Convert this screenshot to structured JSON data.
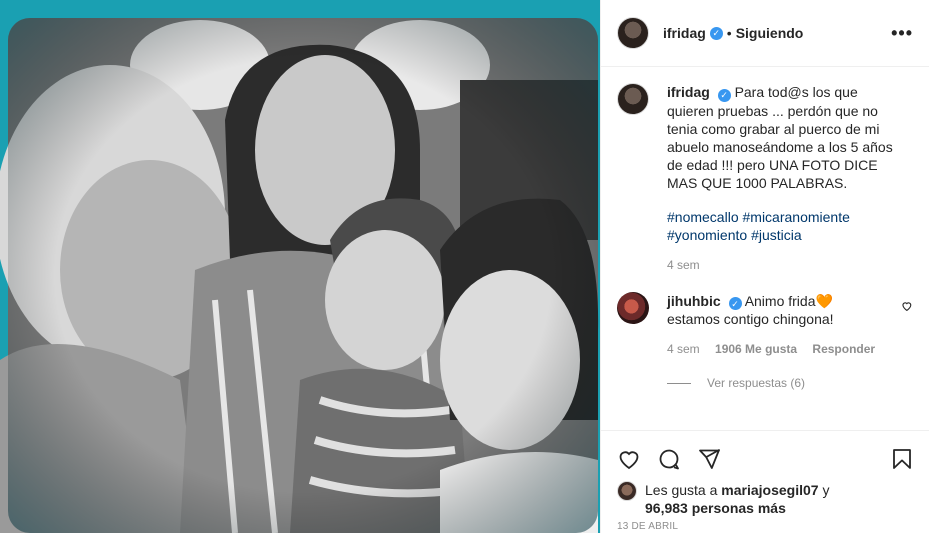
{
  "colors": {
    "photo_bg": "#1b9fb0",
    "verified": "#3897f0",
    "hashtag": "#00376b",
    "muted": "#8e8e8e"
  },
  "header": {
    "username": "ifridag",
    "separator": "•",
    "follow_status": "Siguiendo",
    "more_icon": "more-horizontal-icon"
  },
  "caption": {
    "username": "ifridag",
    "text": "Para tod@s los que quieren pruebas ... perdón que no tenia como grabar al puerco de mi abuelo manoseándome a los 5 años de edad !!! pero UNA FOTO DICE MAS QUE 1000 PALABRAS.",
    "hashtags": [
      "#nomecallo",
      "#micaranomiente",
      "#yonomiento",
      "#justicia"
    ],
    "age": "4 sem"
  },
  "reply": {
    "username": "jihuhbic",
    "text_line1": "Animo frida",
    "emoji": "🧡",
    "text_line2": "estamos contigo chingona!",
    "age": "4 sem",
    "likes": "1906 Me gusta",
    "reply_label": "Responder",
    "view_replies": "Ver respuestas (6)"
  },
  "likes": {
    "prefix": "Les gusta a",
    "user": "mariajosegil07",
    "conj": "y",
    "count": "96,983 personas más"
  },
  "date": "13 DE ABRIL",
  "icons": [
    "heart-icon",
    "comment-icon",
    "share-icon",
    "save-icon"
  ]
}
